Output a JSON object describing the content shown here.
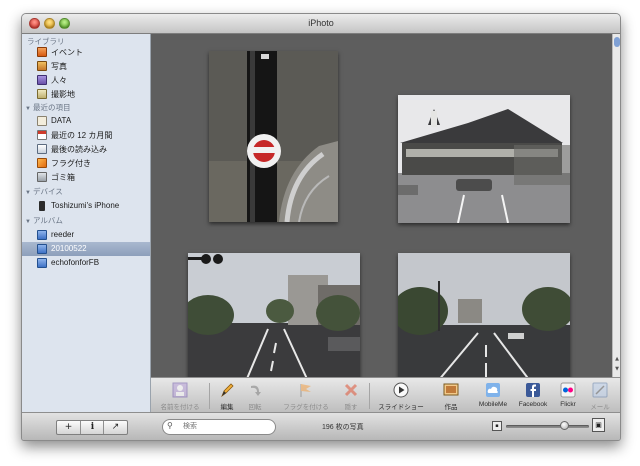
{
  "window": {
    "title": "iPhoto"
  },
  "sidebar": {
    "library": {
      "heading": "ライブラリ",
      "items": [
        {
          "label": "イベント",
          "icon": "events-icon",
          "color": "#e26a1c"
        },
        {
          "label": "写真",
          "icon": "photos-icon",
          "color": "#d9842a"
        },
        {
          "label": "人々",
          "icon": "faces-icon",
          "color": "#7a63b8"
        },
        {
          "label": "撮影地",
          "icon": "places-icon",
          "color": "#cc3a2a"
        }
      ]
    },
    "recent": {
      "heading": "最近の項目",
      "items": [
        {
          "label": "DATA",
          "icon": "event-icon",
          "color": "#e8e2d0"
        },
        {
          "label": "最近の 12 カ月間",
          "icon": "calendar-icon",
          "color": "#cf3b2b"
        },
        {
          "label": "最後の読み込み",
          "icon": "import-icon",
          "color": "#5c6b80"
        },
        {
          "label": "フラグ付き",
          "icon": "flag-icon",
          "color": "#f08a1c"
        },
        {
          "label": "ゴミ箱",
          "icon": "trash-icon",
          "color": "#9aa1a8"
        }
      ]
    },
    "devices": {
      "heading": "デバイス",
      "items": [
        {
          "label": "Toshizumi's iPhone",
          "icon": "iphone-icon",
          "color": "#2b2b2b"
        }
      ]
    },
    "albums": {
      "heading": "アルバム",
      "items": [
        {
          "label": "reeder",
          "icon": "album-icon",
          "color": "#4b7fd1"
        },
        {
          "label": "20100522",
          "icon": "album-icon",
          "color": "#4b7fd1",
          "selected": true
        },
        {
          "label": "echofonforFB",
          "icon": "album-icon",
          "color": "#4b7fd1"
        }
      ]
    }
  },
  "toolbar": {
    "name_label": "名前を付ける",
    "edit_label": "編集",
    "rotate_label": "回転",
    "flag_label": "フラグを付ける",
    "hide_label": "隠す",
    "slideshow_label": "スライドショー",
    "create_label": "作品",
    "mobileme_label": "MobileMe",
    "facebook_label": "Facebook",
    "flickr_label": "Flickr",
    "mail_label": "メール"
  },
  "bottom": {
    "add_symbol": "+",
    "info_symbol": "i",
    "fullscreen_symbol": "↗",
    "search_placeholder": "検索",
    "photo_count": "196 枚の写真"
  },
  "colors": {
    "main_bg": "#5e5e5e",
    "sidebar_bg": "#dde4ee",
    "selection": "#8d9fbb"
  }
}
